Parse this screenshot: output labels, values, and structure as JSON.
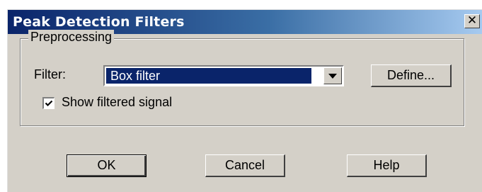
{
  "window": {
    "title": "Peak Detection Filters",
    "close_glyph": "✕"
  },
  "preprocessing": {
    "legend": "Preprocessing",
    "filter_label": "Filter:",
    "filter_value": "Box filter",
    "define_button": "Define...",
    "show_filtered_label": "Show filtered signal",
    "show_filtered_checked": true
  },
  "buttons": {
    "ok": "OK",
    "cancel": "Cancel",
    "help": "Help"
  },
  "icons": {
    "close": "close-icon",
    "dropdown": "chevron-down-icon",
    "check": "checkmark-icon"
  },
  "colors": {
    "title_start": "#0a246a",
    "title_end": "#a6caf0",
    "face": "#d4d0c8",
    "selection": "#0a246a"
  }
}
